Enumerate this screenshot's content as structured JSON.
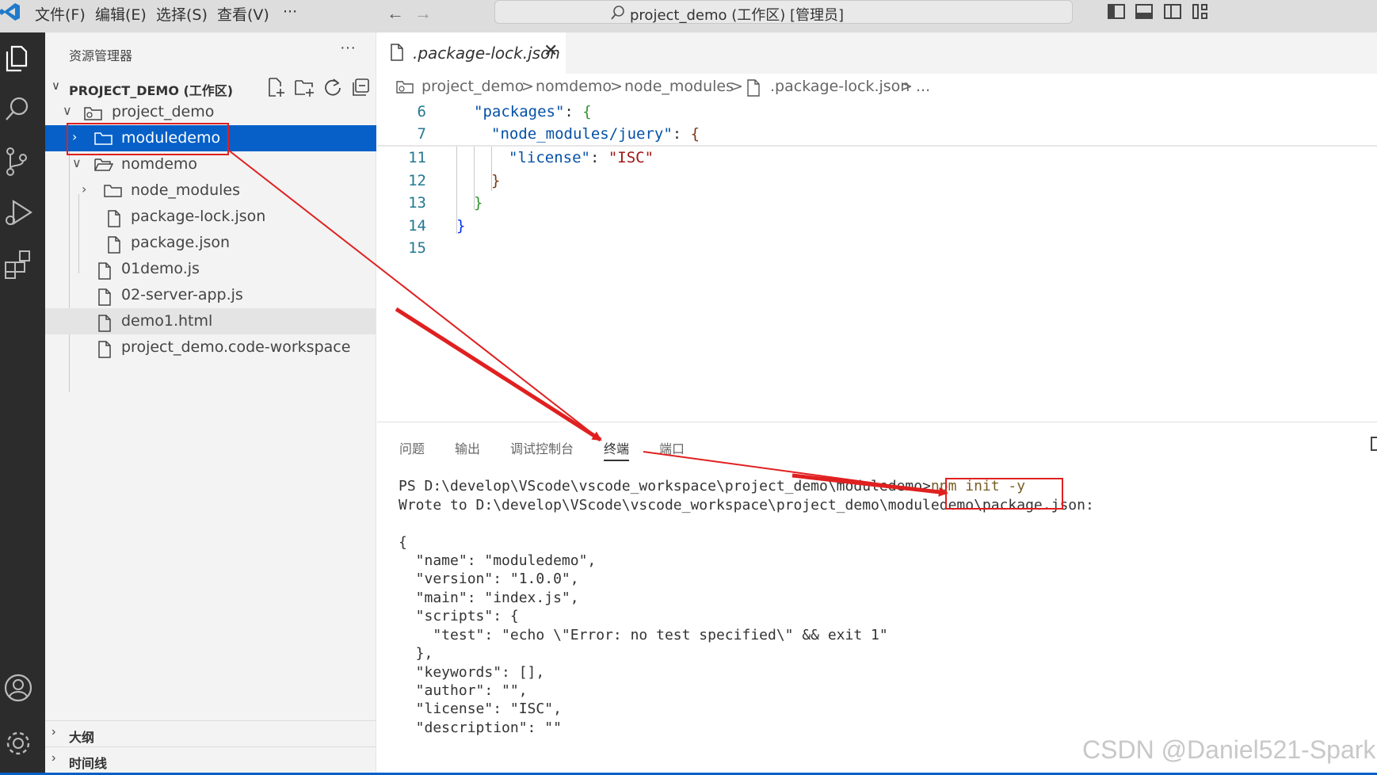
{
  "titlebar": {
    "menus": [
      "文件(F)",
      "编辑(E)",
      "选择(S)",
      "查看(V)",
      "···"
    ],
    "back_icon": "arrow-left-icon",
    "forward_icon": "arrow-right-icon",
    "search_text": "project_demo (工作区) [管理员]"
  },
  "sidebar": {
    "header": "资源管理器",
    "more": "···",
    "workspace": "PROJECT_DEMO (工作区)",
    "tree": [
      {
        "label": "project_demo",
        "type": "root-folder",
        "expanded": true
      },
      {
        "label": "moduledemo",
        "type": "folder",
        "expanded": false,
        "selected": true
      },
      {
        "label": "nomdemo",
        "type": "folder",
        "expanded": true
      },
      {
        "label": "node_modules",
        "type": "folder",
        "expanded": false
      },
      {
        "label": "package-lock.json",
        "type": "file"
      },
      {
        "label": "package.json",
        "type": "file"
      },
      {
        "label": "01demo.js",
        "type": "file"
      },
      {
        "label": "02-server-app.js",
        "type": "file"
      },
      {
        "label": "demo1.html",
        "type": "file"
      },
      {
        "label": "project_demo.code-workspace",
        "type": "file"
      }
    ],
    "outline": "大纲",
    "timeline": "时间线"
  },
  "editor": {
    "tab_title": ".package-lock.json",
    "breadcrumb": [
      "project_demo",
      ">",
      "nomdemo",
      ">",
      "node_modules",
      ">",
      ".package-lock.json",
      ">",
      "..."
    ],
    "line_numbers": [
      "6",
      "7",
      "11",
      "12",
      "13",
      "14",
      "15"
    ]
  },
  "panel": {
    "tabs": [
      "问题",
      "输出",
      "调试控制台",
      "终端",
      "端口"
    ],
    "active_tab": "终端",
    "terminal": {
      "prompt": "PS D:\\develop\\VScode\\vscode_workspace\\project_demo\\moduledemo>",
      "command": "npm init -y",
      "lines": [
        "Wrote to D:\\develop\\VScode\\vscode_workspace\\project_demo\\moduledemo\\package.json:",
        "",
        "{",
        "  \"name\": \"moduledemo\",",
        "  \"version\": \"1.0.0\",",
        "  \"main\": \"index.js\",",
        "  \"scripts\": {",
        "    \"test\": \"echo \\\"Error: no test specified\\\" && exit 1\"",
        "  },",
        "  \"keywords\": [],",
        "  \"author\": \"\",",
        "  \"license\": \"ISC\",",
        "  \"description\": \"\""
      ]
    }
  },
  "watermark": "CSDN @Daniel521-Spark",
  "colors": {
    "selection": "#0660c8",
    "annotation": "#e02020",
    "activity_bar": "#2c2c2c"
  }
}
